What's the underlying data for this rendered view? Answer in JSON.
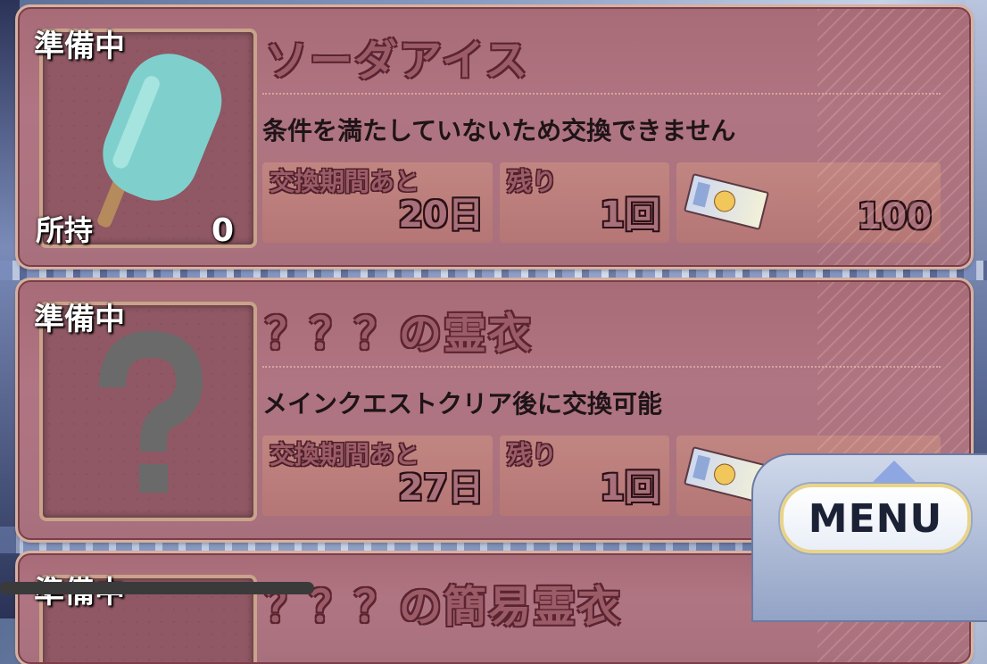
{
  "cards": [
    {
      "status": "準備中",
      "title": "ソーダアイス",
      "description": "条件を満たしていないため交換できません",
      "owned_label": "所持",
      "owned_value": "0",
      "period_label": "交換期間あと",
      "period_value": "20日",
      "remaining_label": "残り",
      "remaining_value": "1回",
      "cost_value": "100",
      "item_icon": "popsicle-icon"
    },
    {
      "status": "準備中",
      "title": "？？？の霊衣",
      "description": "メインクエストクリア後に交換可能",
      "period_label": "交換期間あと",
      "period_value": "27日",
      "remaining_label": "残り",
      "remaining_value": "1回",
      "item_icon": "question-mark-icon"
    },
    {
      "status": "準備中",
      "title": "？？？の簡易霊衣"
    }
  ],
  "menu": {
    "label": "MENU"
  },
  "colors": {
    "card_bg": "#a86b78",
    "card_border": "#7b3e49",
    "accent": "#e8d48a"
  }
}
